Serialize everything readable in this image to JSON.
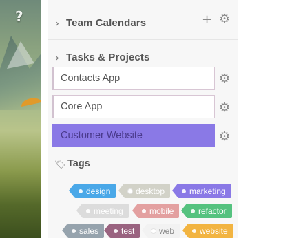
{
  "photo": {
    "help_icon": "?"
  },
  "sections": {
    "team_calendars": {
      "title": "Team Calendars",
      "expand_icon": "chevron-right-icon",
      "add_icon": "plus-icon",
      "settings_icon": "gear-icon"
    },
    "tasks_projects": {
      "title": "Tasks & Projects",
      "expand_icon": "chevron-right-icon"
    }
  },
  "projects": [
    {
      "label": "Contacts App",
      "active": false
    },
    {
      "label": "Core App",
      "active": false
    },
    {
      "label": "Customer Website",
      "active": true
    }
  ],
  "tags_section": {
    "title": "Tags",
    "icon": "tag-icon"
  },
  "tags": [
    {
      "label": "design",
      "color": "#4aa8e8"
    },
    {
      "label": "desktop",
      "color": "#cfcfc4"
    },
    {
      "label": "marketing",
      "color": "#8a79e6"
    },
    {
      "label": "meeting",
      "color": "#dcdcdc"
    },
    {
      "label": "mobile",
      "color": "#e3a0a0"
    },
    {
      "label": "refactor",
      "color": "#55c27f"
    },
    {
      "label": "sales",
      "color": "#96a3ad"
    },
    {
      "label": "test",
      "color": "#9a6380"
    },
    {
      "label": "web",
      "color": "#f2f2f2"
    },
    {
      "label": "website",
      "color": "#f2b441"
    }
  ]
}
